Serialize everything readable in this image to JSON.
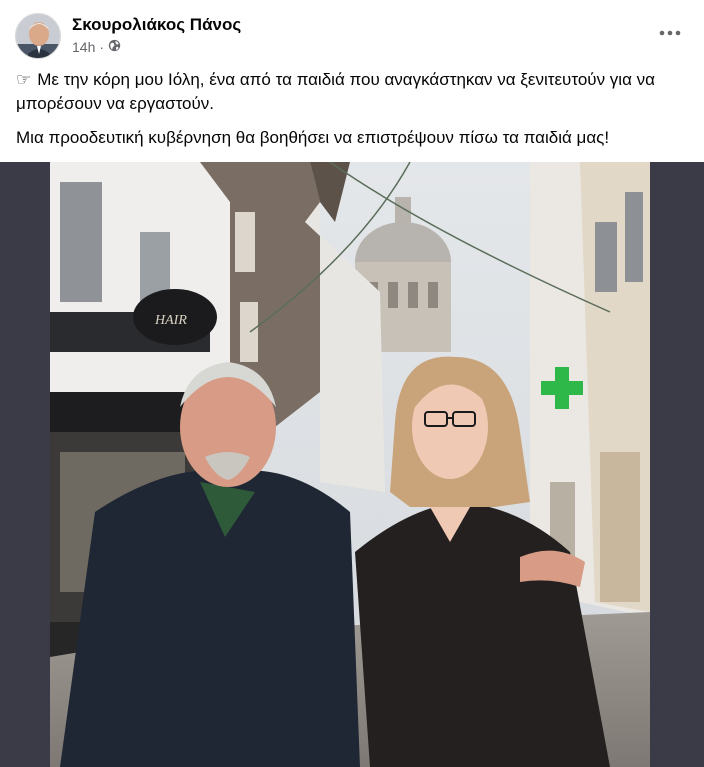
{
  "post": {
    "author": "Σκουρολιάκος Πάνος",
    "time": "14h",
    "separator": "·",
    "audience_icon": "globe-icon",
    "more_icon": "more-options-icon",
    "hand_icon": "☞",
    "text_line_1": "Με την κόρη μου Ιόλη, ένα από τα παιδιά που αναγκάστηκαν να ξενιτευτούν για να μπορέσουν να εργαστούν.",
    "text_line_2": "Μια προοδευτική κυβέρνηση θα βοηθήσει να επιστρέψουν πίσω τα παιδιά μας!"
  },
  "photo": {
    "shop_sign": "HAIR",
    "pharmacy_cross_color": "#2fb84a"
  },
  "colors": {
    "text": "#050505",
    "secondary": "#65676b",
    "photo_bg": "#3a3b46"
  }
}
